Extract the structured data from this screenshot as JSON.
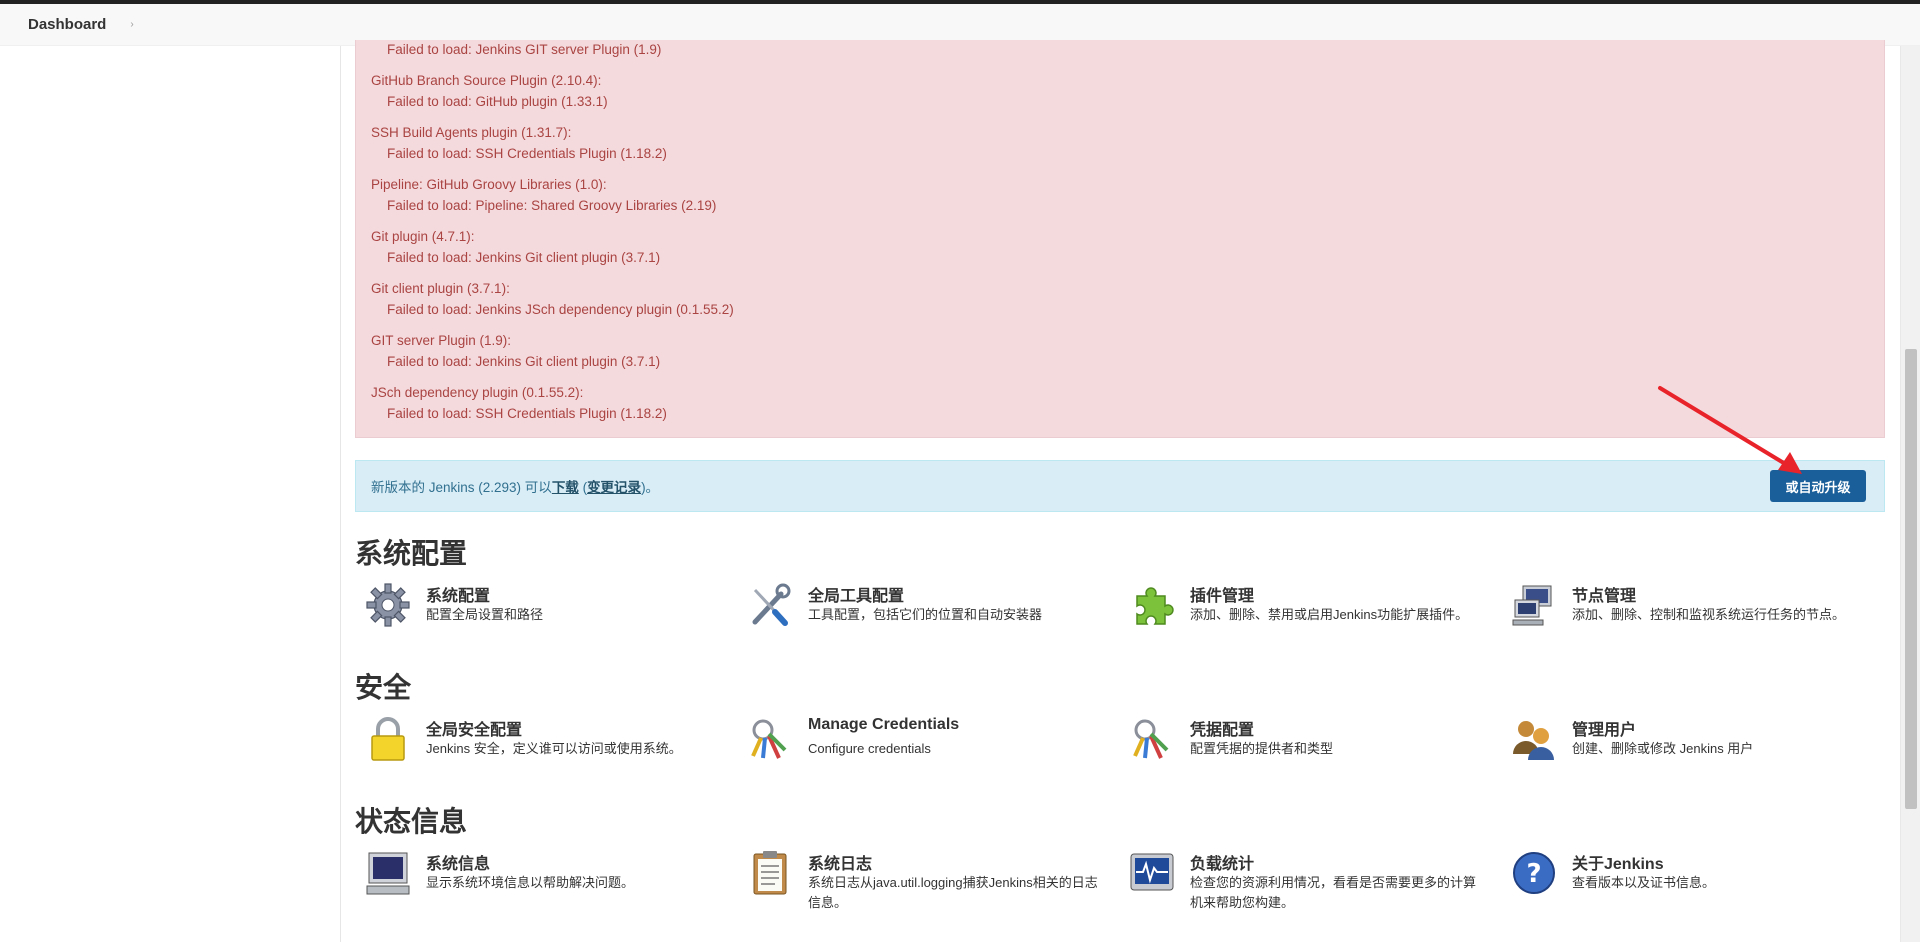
{
  "breadcrumb": {
    "home": "Dashboard",
    "arrow": "›"
  },
  "errors": [
    {
      "type": "sub",
      "text": "Failed to load: Jenkins GIT server Plugin (1.9)"
    },
    {
      "type": "head",
      "text": "GitHub Branch Source Plugin (2.10.4):"
    },
    {
      "type": "sub",
      "text": "Failed to load: GitHub plugin (1.33.1)"
    },
    {
      "type": "head",
      "text": "SSH Build Agents plugin (1.31.7):"
    },
    {
      "type": "sub",
      "text": "Failed to load: SSH Credentials Plugin (1.18.2)"
    },
    {
      "type": "head",
      "text": "Pipeline: GitHub Groovy Libraries (1.0):"
    },
    {
      "type": "sub",
      "text": "Failed to load: Pipeline: Shared Groovy Libraries (2.19)"
    },
    {
      "type": "head",
      "text": "Git plugin (4.7.1):"
    },
    {
      "type": "sub",
      "text": "Failed to load: Jenkins Git client plugin (3.7.1)"
    },
    {
      "type": "head",
      "text": "Git client plugin (3.7.1):"
    },
    {
      "type": "sub",
      "text": "Failed to load: Jenkins JSch dependency plugin (0.1.55.2)"
    },
    {
      "type": "head",
      "text": "GIT server Plugin (1.9):"
    },
    {
      "type": "sub",
      "text": "Failed to load: Jenkins Git client plugin (3.7.1)"
    },
    {
      "type": "head",
      "text": "JSch dependency plugin (0.1.55.2):"
    },
    {
      "type": "sub",
      "text": "Failed to load: SSH Credentials Plugin (1.18.2)"
    }
  ],
  "update": {
    "text_before": "新版本的 Jenkins (2.293) 可以",
    "download_link": "下载",
    "text_mid": " (",
    "changelog_link": "变更记录",
    "text_after": ")。",
    "upgrade_button": "或自动升级"
  },
  "sections": [
    {
      "title": "系统配置",
      "items": [
        {
          "icon": "gear-icon",
          "title": "系统配置",
          "desc": "配置全局设置和路径"
        },
        {
          "icon": "tools-icon",
          "title": "全局工具配置",
          "desc": "工具配置，包括它们的位置和自动安装器"
        },
        {
          "icon": "puzzle-icon",
          "title": "插件管理",
          "desc": "添加、删除、禁用或启用Jenkins功能扩展插件。"
        },
        {
          "icon": "computer-network-icon",
          "title": "节点管理",
          "desc": "添加、删除、控制和监视系统运行任务的节点。"
        }
      ]
    },
    {
      "title": "安全",
      "items": [
        {
          "icon": "lock-icon",
          "title": "全局安全配置",
          "desc": "Jenkins 安全，定义谁可以访问或使用系统。"
        },
        {
          "icon": "keys-icon",
          "title": "Manage Credentials",
          "desc": "Configure credentials"
        },
        {
          "icon": "keys-icon",
          "title": "凭据配置",
          "desc": "配置凭据的提供者和类型"
        },
        {
          "icon": "users-icon",
          "title": "管理用户",
          "desc": "创建、删除或修改 Jenkins 用户"
        }
      ]
    },
    {
      "title": "状态信息",
      "items": [
        {
          "icon": "monitor-icon",
          "title": "系统信息",
          "desc": "显示系统环境信息以帮助解决问题。"
        },
        {
          "icon": "clipboard-icon",
          "title": "系统日志",
          "desc": "系统日志从java.util.logging捕获Jenkins相关的日志信息。"
        },
        {
          "icon": "load-monitor-icon",
          "title": "负载统计",
          "desc": "检查您的资源利用情况，看看是否需要更多的计算机来帮助您构建。"
        },
        {
          "icon": "help-icon",
          "title": "关于Jenkins",
          "desc": "查看版本以及证书信息。"
        }
      ]
    }
  ]
}
